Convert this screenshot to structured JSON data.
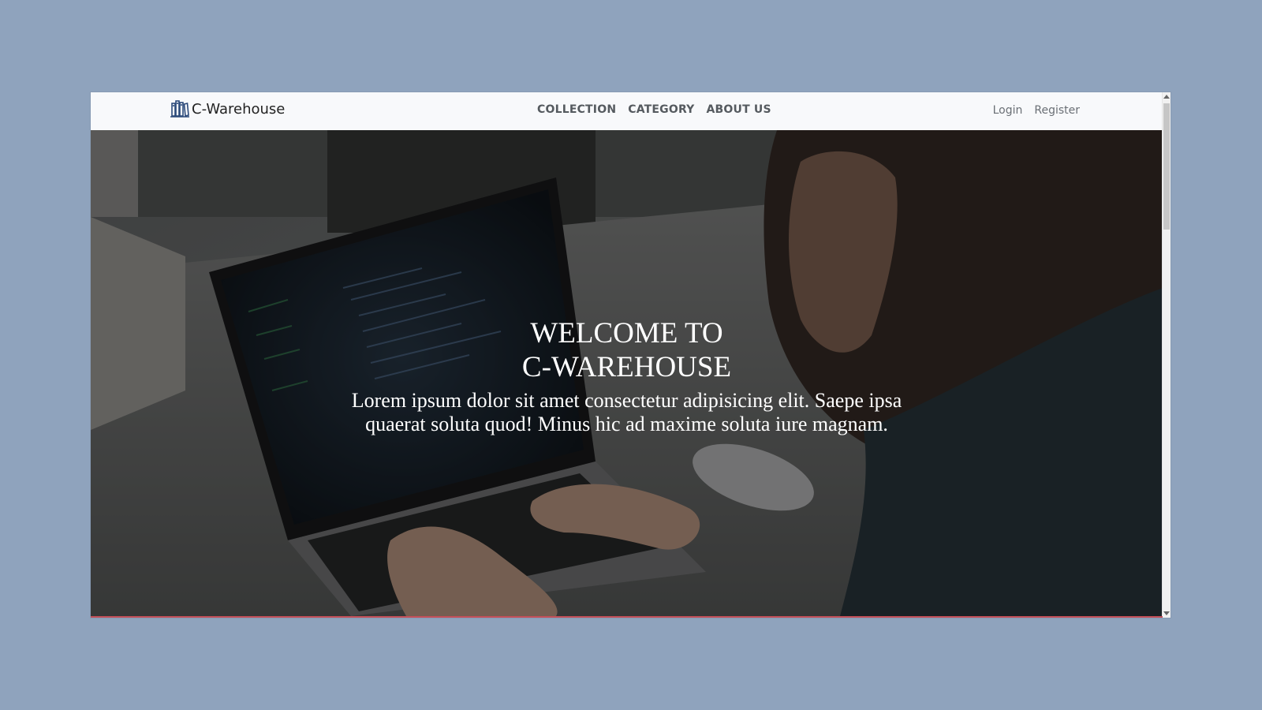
{
  "navbar": {
    "brand_label": "C-Warehouse",
    "brand_icon": "library-books-icon",
    "links": [
      {
        "label": "COLLECTION"
      },
      {
        "label": "CATEGORY"
      },
      {
        "label": "ABOUT US"
      }
    ],
    "auth": {
      "login_label": "Login",
      "register_label": "Register"
    }
  },
  "hero": {
    "title_line1": "WELCOME TO",
    "title_line2": "C-WAREHOUSE",
    "subtitle": "Lorem ipsum dolor sit amet consectetur adipisicing elit. Saepe ipsa quaerat soluta quod! Minus hic ad maxime soluta iure magnam.",
    "background_image": "person-typing-on-laptop-photo"
  },
  "colors": {
    "page_background": "#8fa3bd",
    "navbar_background": "#f8f9fb",
    "brand_icon_color": "#2c4a7a",
    "hero_text": "#ffffff"
  }
}
